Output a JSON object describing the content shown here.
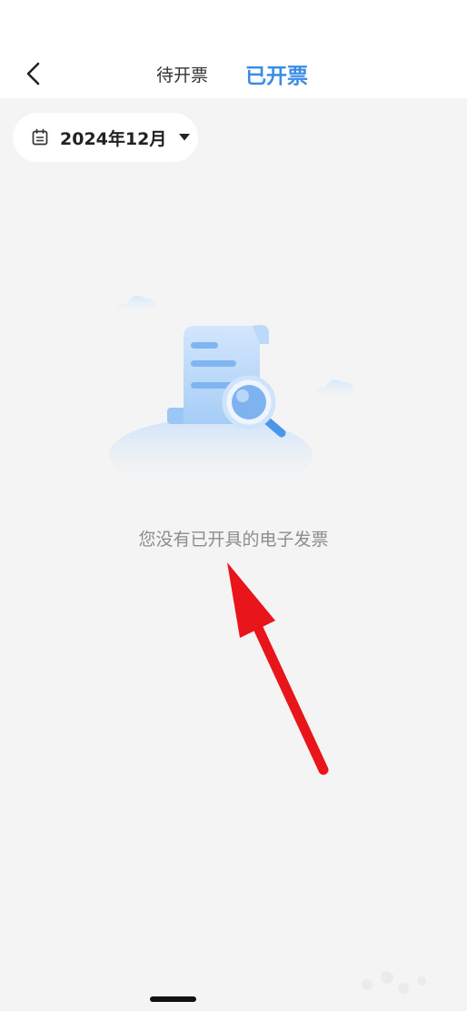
{
  "header": {
    "back_icon": "chevron-left-icon",
    "tabs": [
      {
        "label": "待开票",
        "active": false
      },
      {
        "label": "已开票",
        "active": true
      }
    ],
    "active_color": "#3a8de6"
  },
  "filter": {
    "icon": "calendar-icon",
    "month_label": "2024年12月",
    "dropdown_icon": "caret-down-icon"
  },
  "empty_state": {
    "illustration": "invoice-search-illustration",
    "message": "您没有已开具的电子发票"
  },
  "annotation": {
    "icon": "red-arrow",
    "color": "#e8161b"
  }
}
